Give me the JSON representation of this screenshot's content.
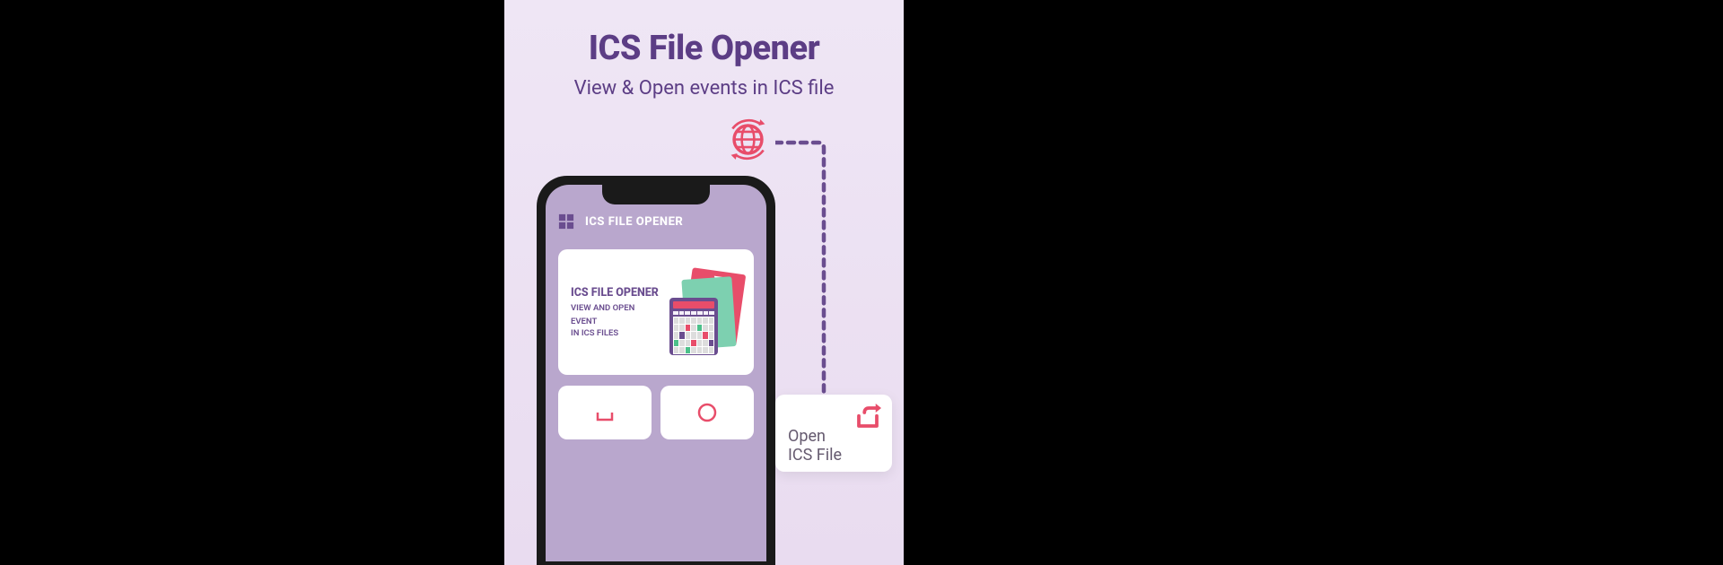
{
  "promo": {
    "title": "ICS File Opener",
    "subtitle": "View & Open events in ICS file"
  },
  "app": {
    "header_title": "ICS FILE OPENER",
    "card": {
      "title": "ICS FILE OPENER",
      "line1": "VIEW AND OPEN EVENT",
      "line2": "IN ICS FILES"
    }
  },
  "callout": {
    "line1": "Open",
    "line2": "ICS File"
  },
  "colors": {
    "accent_purple": "#5c3d85",
    "accent_pink": "#e84d6a",
    "panel_bg": "#eadff1"
  }
}
